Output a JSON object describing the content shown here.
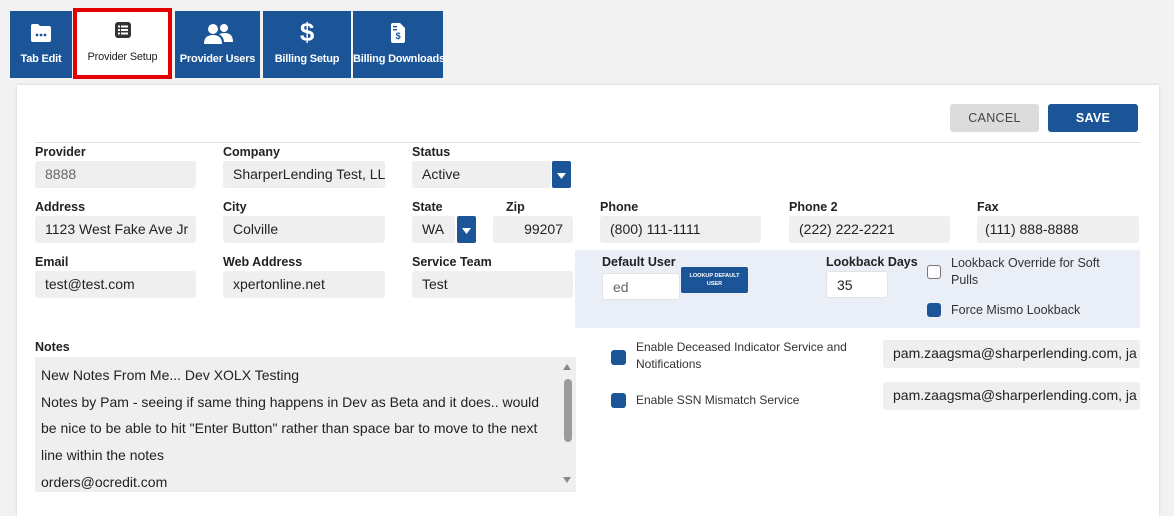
{
  "tabs": [
    {
      "label": "Tab Edit",
      "icon": "folder-icon"
    },
    {
      "label": "Provider Setup",
      "icon": "list-icon",
      "active": true
    },
    {
      "label": "Provider Users",
      "icon": "users-icon"
    },
    {
      "label": "Billing Setup",
      "icon": "dollar-icon"
    },
    {
      "label": "Billing Downloads",
      "icon": "invoice-icon"
    }
  ],
  "actions": {
    "cancel": "CANCEL",
    "save": "SAVE"
  },
  "form": {
    "provider": {
      "label": "Provider",
      "value": "8888"
    },
    "company": {
      "label": "Company",
      "value": "SharperLending Test, LLC"
    },
    "status": {
      "label": "Status",
      "value": "Active"
    },
    "address": {
      "label": "Address",
      "value": "1123 West Fake Ave Jr"
    },
    "city": {
      "label": "City",
      "value": "Colville"
    },
    "state": {
      "label": "State",
      "value": "WA"
    },
    "zip": {
      "label": "Zip",
      "value": "99207"
    },
    "phone": {
      "label": "Phone",
      "value": "(800) 111-1111"
    },
    "phone2": {
      "label": "Phone 2",
      "value": "(222) 222-2221"
    },
    "fax": {
      "label": "Fax",
      "value": "(111) 888-8888"
    },
    "email": {
      "label": "Email",
      "value": "test@test.com"
    },
    "web": {
      "label": "Web Address",
      "value": "xpertonline.net"
    },
    "service_team": {
      "label": "Service Team",
      "value": "Test"
    },
    "default_user": {
      "label": "Default User",
      "value": "ed",
      "lookup_line1": "LOOKUP DEFAULT",
      "lookup_line2": "USER"
    },
    "lookback_days": {
      "label": "Lookback Days",
      "value": "35"
    },
    "lookback_override": {
      "label_line1": "Lookback Override for Soft",
      "label_line2": "Pulls",
      "checked": false
    },
    "force_mismo": {
      "label": "Force Mismo Lookback",
      "checked": true
    }
  },
  "notes": {
    "label": "Notes",
    "lines": [
      "New Notes From Me... Dev XOLX Testing",
      "Notes by Pam - seeing if same thing happens in Dev as Beta and it does.. would",
      "be nice to be able to hit \"Enter Button\" rather than space bar to move to the next",
      "line within the notes",
      "orders@ocredit.com"
    ]
  },
  "services": {
    "deceased": {
      "label_line1": "Enable Deceased Indicator Service and",
      "label_line2": "Notifications",
      "checked": true,
      "email": "pam.zaagsma@sharperlending.com, ja"
    },
    "ssn": {
      "label": "Enable SSN Mismatch Service",
      "checked": true,
      "email": "pam.zaagsma@sharperlending.com, ja"
    }
  },
  "colors": {
    "primary": "#1b5597",
    "active_tab_border": "#e50000",
    "field_bg": "#efefef",
    "blue_box_bg": "#e9eef7"
  }
}
